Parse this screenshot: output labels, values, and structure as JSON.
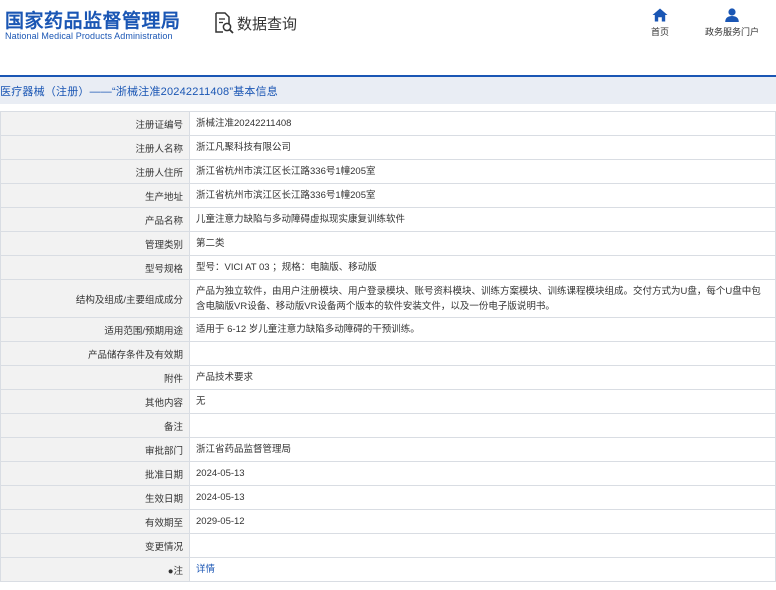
{
  "header": {
    "logo_cn": "国家药品监督管理局",
    "logo_en": "National Medical Products Administration",
    "query_label": "数据查询",
    "nav": {
      "home": "首页",
      "service": "政务服务门户"
    }
  },
  "title": "医疗器械（注册）——“浙械注准20242211408”基本信息",
  "rows": [
    {
      "label": "注册证编号",
      "value": "浙械注准20242211408"
    },
    {
      "label": "注册人名称",
      "value": "浙江凡聚科技有限公司"
    },
    {
      "label": "注册人住所",
      "value": "浙江省杭州市滨江区长江路336号1幢205室"
    },
    {
      "label": "生产地址",
      "value": "浙江省杭州市滨江区长江路336号1幢205室"
    },
    {
      "label": "产品名称",
      "value": "儿童注意力缺陷与多动障碍虚拟现实康复训练软件"
    },
    {
      "label": "管理类别",
      "value": "第二类"
    },
    {
      "label": "型号规格",
      "value": "型号：VICI AT 03 ；规格：电脑版、移动版"
    },
    {
      "label": "结构及组成/主要组成成分",
      "value": "产品为独立软件，由用户注册模块、用户登录模块、账号资料模块、训练方案模块、训练课程模块组成。交付方式为U盘，每个U盘中包含电脑版VR设备、移动版VR设备两个版本的软件安装文件，以及一份电子版说明书。"
    },
    {
      "label": "适用范围/预期用途",
      "value": "适用于 6-12 岁儿童注意力缺陷多动障碍的干预训练。"
    },
    {
      "label": "产品储存条件及有效期",
      "value": ""
    },
    {
      "label": "附件",
      "value": "产品技术要求"
    },
    {
      "label": "其他内容",
      "value": "无"
    },
    {
      "label": "备注",
      "value": ""
    },
    {
      "label": "审批部门",
      "value": "浙江省药品监督管理局"
    },
    {
      "label": "批准日期",
      "value": "2024-05-13"
    },
    {
      "label": "生效日期",
      "value": "2024-05-13"
    },
    {
      "label": "有效期至",
      "value": "2029-05-12"
    },
    {
      "label": "变更情况",
      "value": ""
    },
    {
      "label": "●注",
      "value": "详情"
    }
  ]
}
